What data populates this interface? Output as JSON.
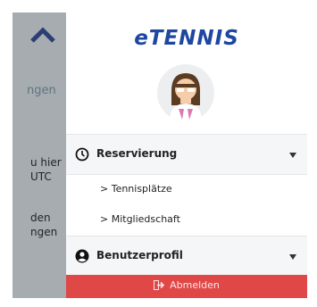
{
  "background": {
    "link_text": "ngen",
    "text_lines": [
      "u hier",
      "UTC",
      "den",
      "ngen"
    ]
  },
  "brand": {
    "logo": "eTENNIS"
  },
  "avatar": {
    "icon": "user-avatar-icon"
  },
  "menu": {
    "reservierung": {
      "label": "Reservierung",
      "icon": "clock-icon",
      "items": [
        "> Tennisplätze",
        "> Mitgliedschaft"
      ]
    },
    "benutzerprofil": {
      "label": "Benutzerprofil",
      "icon": "user-circle-icon"
    }
  },
  "logout": {
    "label": "Abmelden",
    "icon": "sign-out-icon"
  },
  "colors": {
    "brand_blue": "#1e47a1",
    "logout_red": "#e04848",
    "backdrop_gray": "#a6acb0"
  }
}
